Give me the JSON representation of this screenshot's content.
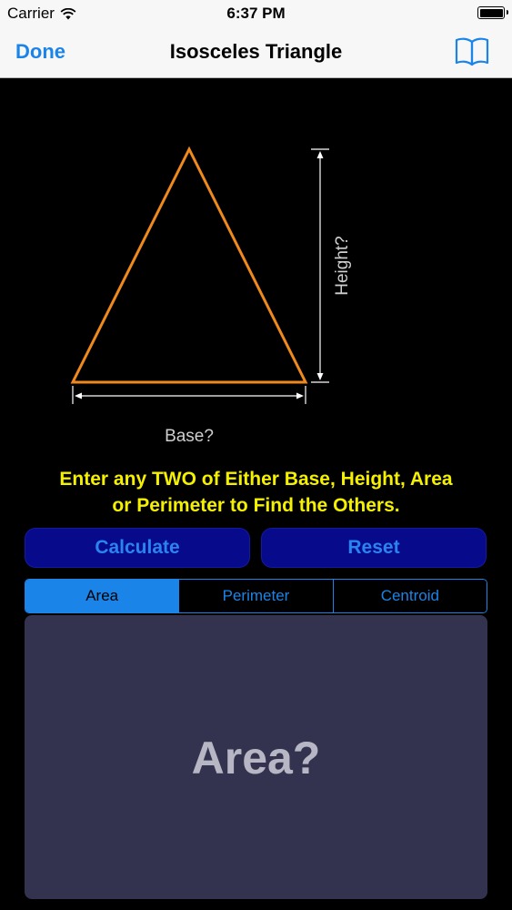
{
  "status_bar": {
    "carrier": "Carrier",
    "time": "6:37 PM",
    "battery_level": 1.0
  },
  "nav": {
    "done_label": "Done",
    "title": "Isosceles Triangle",
    "right_icon": "book-icon"
  },
  "diagram": {
    "height_label": "Height?",
    "base_label": "Base?",
    "triangle_color": "#f08a1c",
    "dimension_color": "#ffffff"
  },
  "instructions": {
    "line1": "Enter any TWO of Either Base, Height, Area",
    "line2": "or Perimeter to Find the Others."
  },
  "buttons": {
    "calculate": "Calculate",
    "reset": "Reset"
  },
  "tabs": [
    {
      "label": "Area",
      "selected": true
    },
    {
      "label": "Perimeter",
      "selected": false
    },
    {
      "label": "Centroid",
      "selected": false
    }
  ],
  "result": {
    "placeholder": "Area?"
  },
  "colors": {
    "accent": "#1a84e8",
    "button_bg": "#080a8c",
    "instruction_text": "#f5f000",
    "panel_bg": "#33334f"
  }
}
